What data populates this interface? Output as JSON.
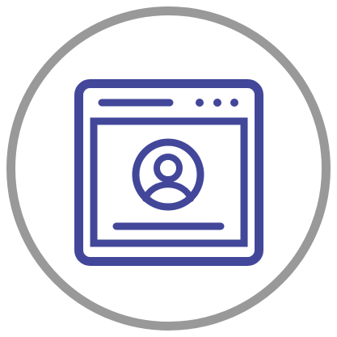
{
  "icon": {
    "name": "web-profile-icon",
    "colors": {
      "ring": "#999999",
      "stroke": "#42479a",
      "background": "#ffffff"
    }
  }
}
